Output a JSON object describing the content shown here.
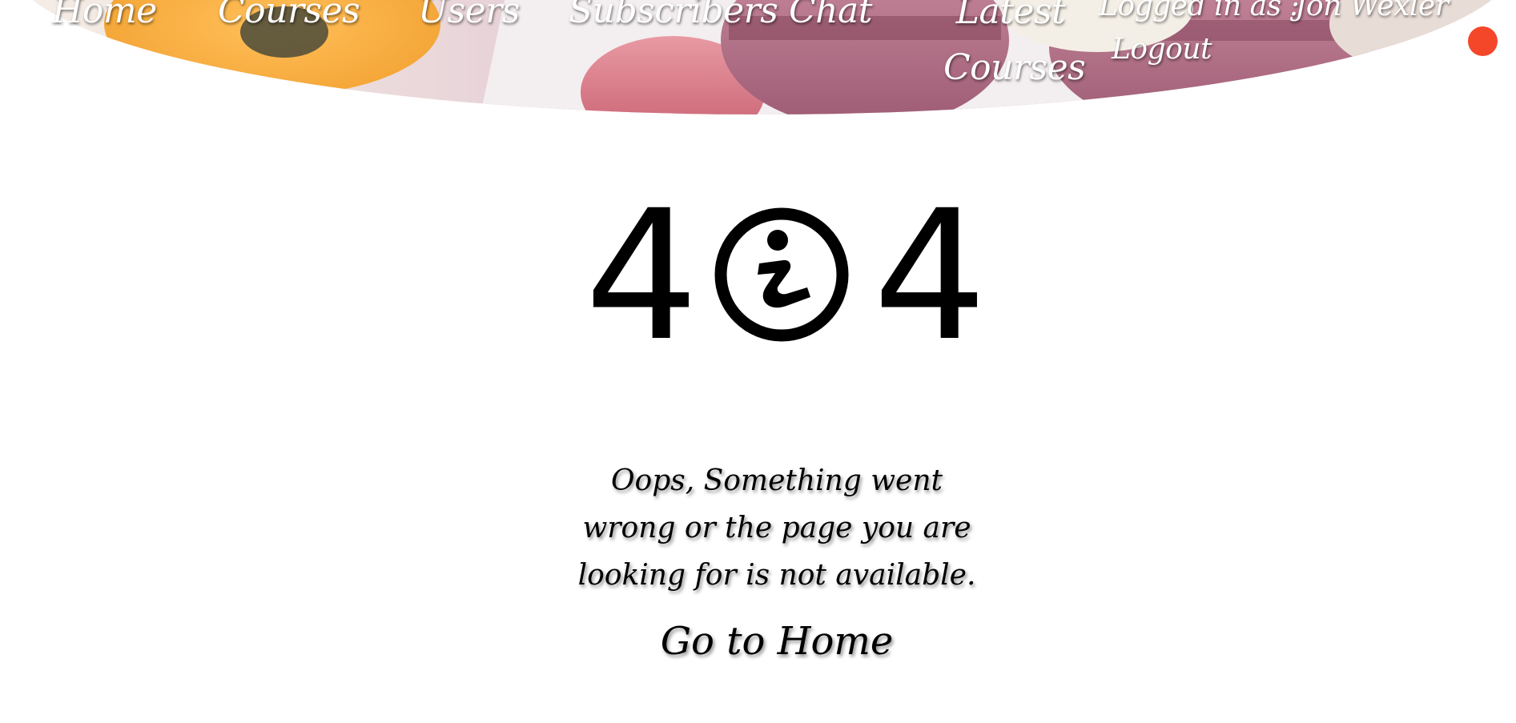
{
  "header": {
    "nav": {
      "home": "Home",
      "courses": "Courses",
      "users": "Users",
      "subscribers": "Subscribers",
      "chat": "Chat",
      "latest_courses": "Latest Courses"
    },
    "logged_in_label": "Logged in as :",
    "user_name": "Jon Wexler",
    "logout": "Logout",
    "notification_color": "#f44729"
  },
  "error": {
    "code_left_digit": "4",
    "code_icon": "info-circle-icon",
    "code_right_digit": "4",
    "message": "Oops, Something went wrong or the page you are looking for is not available.",
    "home_link": "Go to Home"
  }
}
